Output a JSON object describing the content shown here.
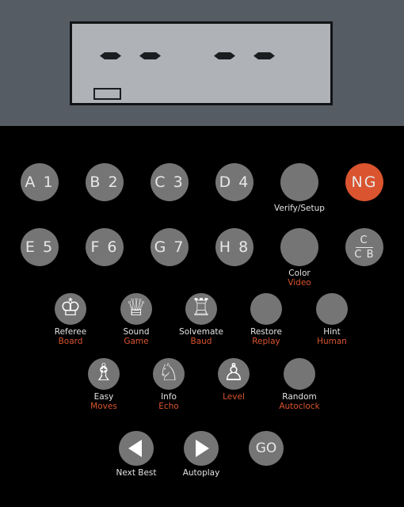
{
  "device": {
    "name": "Electronic Chess Computer Keypad",
    "colors": {
      "housing": "#555C63",
      "lcd_background": "#AFB2B6",
      "lcd_segment": "#1B1D20",
      "keypad_background": "#000000",
      "key_gray": "#757575",
      "key_accent": "#D9542F",
      "label_primary": "#E3E3E3",
      "label_secondary": "#D9542F"
    }
  },
  "display": {
    "segments": [
      "-",
      "-",
      "-",
      "-"
    ],
    "status_indicator": "",
    "status_indicator_name": "empty-status-box"
  },
  "keypad": {
    "rows": [
      {
        "row_name": "coordinate-row-1",
        "keys": [
          {
            "face": "A 1",
            "name": "key-a1",
            "style": "big",
            "accent": false,
            "label_main": "",
            "label_sub": ""
          },
          {
            "face": "B 2",
            "name": "key-b2",
            "style": "big",
            "accent": false,
            "label_main": "",
            "label_sub": ""
          },
          {
            "face": "C 3",
            "name": "key-c3",
            "style": "big",
            "accent": false,
            "label_main": "",
            "label_sub": ""
          },
          {
            "face": "D 4",
            "name": "key-d4",
            "style": "big",
            "accent": false,
            "label_main": "",
            "label_sub": ""
          },
          {
            "face": "",
            "name": "key-verify-setup",
            "style": "big",
            "accent": false,
            "label_main": "Verify/Setup",
            "label_sub": ""
          },
          {
            "face": "NG",
            "name": "key-new-game",
            "style": "big",
            "accent": true,
            "label_main": "",
            "label_sub": ""
          }
        ]
      },
      {
        "row_name": "coordinate-row-2",
        "keys": [
          {
            "face": "E 5",
            "name": "key-e5",
            "style": "big",
            "accent": false,
            "label_main": "",
            "label_sub": ""
          },
          {
            "face": "F 6",
            "name": "key-f6",
            "style": "big",
            "accent": false,
            "label_main": "",
            "label_sub": ""
          },
          {
            "face": "G 7",
            "name": "key-g7",
            "style": "big",
            "accent": false,
            "label_main": "",
            "label_sub": ""
          },
          {
            "face": "H 8",
            "name": "key-h8",
            "style": "big",
            "accent": false,
            "label_main": "",
            "label_sub": ""
          },
          {
            "face": "",
            "name": "key-color-video",
            "style": "big",
            "accent": false,
            "label_main": "Color",
            "label_sub": "Video"
          },
          {
            "face_numerator": "C",
            "face_denominator": "C B",
            "name": "key-clear-cb",
            "style": "big",
            "accent": false,
            "label_main": "",
            "label_sub": ""
          }
        ]
      },
      {
        "row_name": "function-row-1",
        "keys": [
          {
            "glyph": "♔",
            "glyph_name": "chess-king-icon",
            "name": "key-referee-board",
            "style": "icon",
            "accent": false,
            "label_main": "Referee",
            "label_sub": "Board"
          },
          {
            "glyph": "♕",
            "glyph_name": "chess-queen-icon",
            "name": "key-sound-game",
            "style": "icon",
            "accent": false,
            "label_main": "Sound",
            "label_sub": "Game"
          },
          {
            "glyph": "♖",
            "glyph_name": "chess-rook-icon",
            "name": "key-solvemate-baud",
            "style": "icon",
            "accent": false,
            "label_main": "Solvemate",
            "label_sub": "Baud"
          },
          {
            "glyph": "",
            "glyph_name": "",
            "name": "key-restore-replay",
            "style": "icon",
            "accent": false,
            "label_main": "Restore",
            "label_sub": "Replay"
          },
          {
            "glyph": "",
            "glyph_name": "",
            "name": "key-hint-human",
            "style": "icon",
            "accent": false,
            "label_main": "Hint",
            "label_sub": "Human"
          }
        ]
      },
      {
        "row_name": "function-row-2",
        "keys": [
          {
            "glyph": "♗",
            "glyph_name": "chess-bishop-icon",
            "name": "key-easy-moves",
            "style": "icon",
            "accent": false,
            "label_main": "Easy",
            "label_sub": "Moves"
          },
          {
            "glyph": "♘",
            "glyph_name": "chess-knight-icon",
            "name": "key-info-echo",
            "style": "icon",
            "accent": false,
            "label_main": "Info",
            "label_sub": "Echo"
          },
          {
            "glyph": "♙",
            "glyph_name": "chess-pawn-icon",
            "name": "key-level",
            "style": "icon",
            "accent": false,
            "label_main": "",
            "label_sub": "Level"
          },
          {
            "glyph": "",
            "glyph_name": "",
            "name": "key-random-autoclock",
            "style": "icon",
            "accent": false,
            "label_main": "Random",
            "label_sub": "Autoclock"
          }
        ]
      },
      {
        "row_name": "transport-row",
        "keys": [
          {
            "glyph_name": "triangle-left-icon",
            "name": "key-next-best",
            "style": "mid",
            "accent": false,
            "label_main": "Next Best",
            "label_sub": ""
          },
          {
            "glyph_name": "triangle-right-icon",
            "name": "key-autoplay",
            "style": "mid",
            "accent": false,
            "label_main": "Autoplay",
            "label_sub": ""
          },
          {
            "face": "GO",
            "name": "key-go",
            "style": "go",
            "accent": false,
            "label_main": "",
            "label_sub": ""
          }
        ]
      }
    ]
  }
}
